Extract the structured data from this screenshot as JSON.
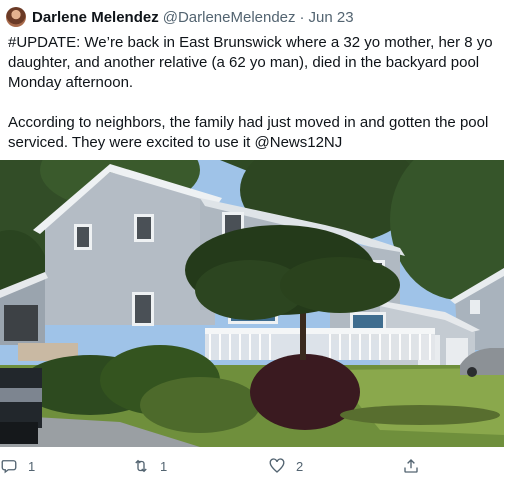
{
  "tweet": {
    "display_name": "Darlene Melendez",
    "handle": "@DarleneMelendez",
    "separator": "·",
    "date": "Jun 23",
    "text": "#UPDATE: We’re back in East Brunswick where a 32 yo mother, her 8 yo daughter, and another relative (a 62 yo man), died in the backyard pool Monday afternoon.\n\nAccording to neighbors, the family had just moved in and gotten the pool serviced. They were excited to use it @News12NJ"
  },
  "actions": {
    "reply": {
      "icon": "reply-icon",
      "count": "1"
    },
    "retweet": {
      "icon": "retweet-icon",
      "count": "1"
    },
    "like": {
      "icon": "heart-icon",
      "count": "2"
    },
    "share": {
      "icon": "share-icon"
    }
  },
  "colors": {
    "text": "#0f1419",
    "secondary": "#536471"
  }
}
